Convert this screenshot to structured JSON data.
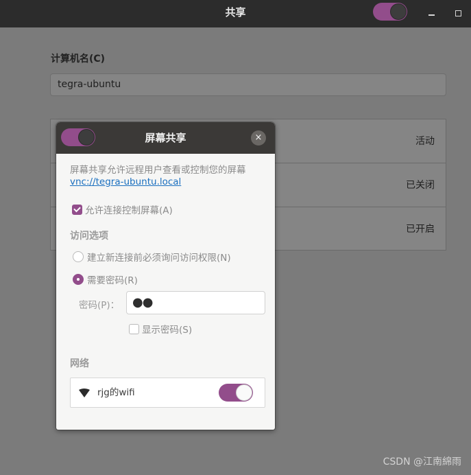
{
  "window": {
    "title": "共享",
    "sharing_toggle": true
  },
  "computer_name": {
    "label": "计算机名(C)",
    "value": "tegra-ubuntu"
  },
  "services": [
    {
      "status": "活动"
    },
    {
      "status": "已关闭"
    },
    {
      "status": "已开启"
    }
  ],
  "dialog": {
    "title": "屏幕共享",
    "enabled": true,
    "close_glyph": "×",
    "description": "屏幕共享允许远程用户查看或控制您的屏幕",
    "link": "vnc://tegra-ubuntu.local",
    "allow_control": {
      "label": "允许连接控制屏幕(A)",
      "checked": true
    },
    "access_options_label": "访问选项",
    "access_options": [
      {
        "label": "建立新连接前必须询问访问权限(N)",
        "selected": false
      },
      {
        "label": "需要密码(R)",
        "selected": true
      }
    ],
    "password": {
      "label": "密码(P)：",
      "value": "●●"
    },
    "show_password": {
      "label": "显示密码(S)",
      "checked": false
    },
    "network_label": "网络",
    "networks": [
      {
        "name": "rjg的wifi",
        "icon": "wifi-icon",
        "enabled": true
      }
    ]
  },
  "watermark": "CSDN @江南綿雨",
  "colors": {
    "accent": "#924d8b",
    "titlebar": "#2c2c2c",
    "dialog_header": "#3b3937",
    "link": "#1a6fbf"
  }
}
